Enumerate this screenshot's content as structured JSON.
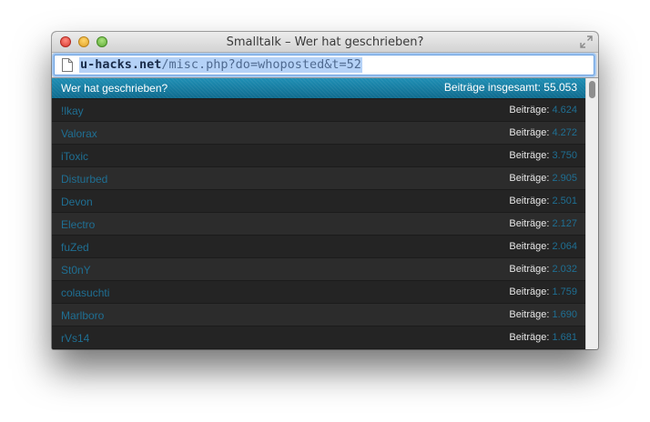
{
  "window": {
    "title": "Smalltalk – Wer hat geschrieben?"
  },
  "address": {
    "domain": "u-hacks.net",
    "path": "/misc.php?do=whoposted&t=52"
  },
  "panel": {
    "heading": "Wer hat geschrieben?",
    "total": "Beiträge insgesamt: 55.053",
    "accent_color": "#1f8fb5"
  },
  "posters": [
    {
      "name": "!lkay",
      "label": "Beiträge:",
      "count": "4.624"
    },
    {
      "name": "Valorax",
      "label": "Beiträge:",
      "count": "4.272"
    },
    {
      "name": "iToxic",
      "label": "Beiträge:",
      "count": "3.750"
    },
    {
      "name": "Disturbed",
      "label": "Beiträge:",
      "count": "2.905"
    },
    {
      "name": "Devon",
      "label": "Beiträge:",
      "count": "2.501"
    },
    {
      "name": "Electro",
      "label": "Beiträge:",
      "count": "2.127"
    },
    {
      "name": "fuZed",
      "label": "Beiträge:",
      "count": "2.064"
    },
    {
      "name": "St0nY",
      "label": "Beiträge:",
      "count": "2.032"
    },
    {
      "name": "colasuchti",
      "label": "Beiträge:",
      "count": "1.759"
    },
    {
      "name": "Marlboro",
      "label": "Beiträge:",
      "count": "1.690"
    },
    {
      "name": "rVs14",
      "label": "Beiträge:",
      "count": "1.681"
    },
    {
      "name": "",
      "label": "",
      "count": ""
    }
  ]
}
